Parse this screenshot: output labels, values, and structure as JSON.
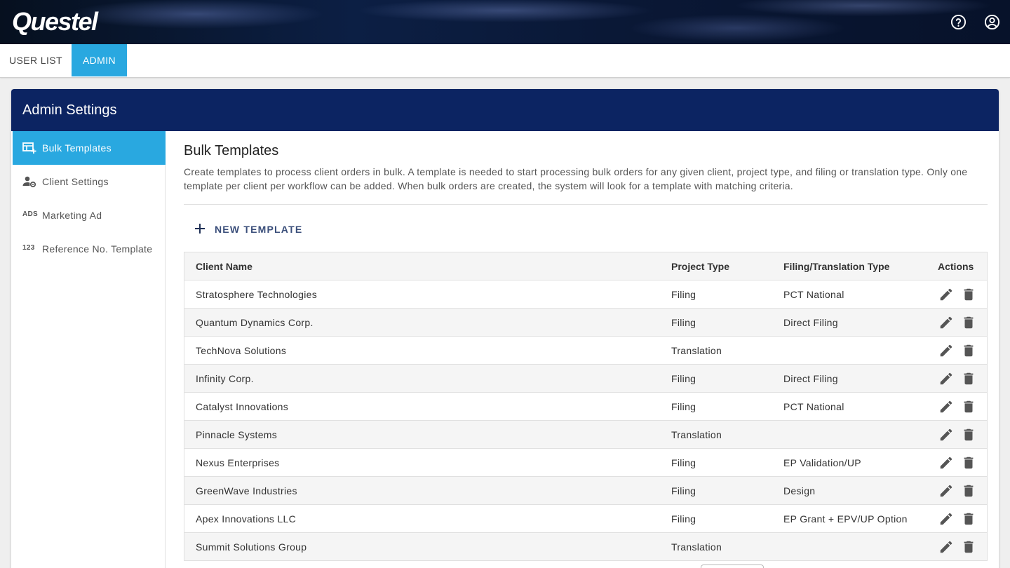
{
  "header": {
    "logo_text": "Questel",
    "help_icon": "help-circle-icon",
    "account_icon": "account-circle-icon"
  },
  "tabs": [
    {
      "label": "USER LIST",
      "active": false
    },
    {
      "label": "ADMIN",
      "active": true
    }
  ],
  "admin": {
    "title": "Admin Settings",
    "sidebar": [
      {
        "label": "Bulk Templates",
        "icon": "table-add-icon",
        "active": true
      },
      {
        "label": "Client Settings",
        "icon": "user-settings-icon",
        "active": false
      },
      {
        "label": "Marketing Ad",
        "icon": "ads-icon",
        "icon_text": "ADS",
        "active": false
      },
      {
        "label": "Reference No. Template",
        "icon": "numbers-icon",
        "icon_text": "123",
        "active": false
      }
    ]
  },
  "main": {
    "title": "Bulk Templates",
    "description": "Create templates to process client orders in bulk. A template is needed to start processing bulk orders for any given client, project type, and filing or translation type. Only one template per client per workflow can be added. When bulk orders are created, the system will look for a template with matching criteria.",
    "new_button_label": "NEW TEMPLATE"
  },
  "table": {
    "columns": [
      "Client Name",
      "Project Type",
      "Filing/Translation Type",
      "Actions"
    ],
    "rows": [
      {
        "client": "Stratosphere Technologies",
        "project": "Filing",
        "filing": "PCT National"
      },
      {
        "client": "Quantum Dynamics Corp.",
        "project": "Filing",
        "filing": "Direct Filing"
      },
      {
        "client": "TechNova Solutions",
        "project": "Translation",
        "filing": ""
      },
      {
        "client": "Infinity Corp.",
        "project": "Filing",
        "filing": "Direct Filing"
      },
      {
        "client": "Catalyst Innovations",
        "project": "Filing",
        "filing": "PCT National"
      },
      {
        "client": "Pinnacle Systems",
        "project": "Translation",
        "filing": ""
      },
      {
        "client": "Nexus Enterprises",
        "project": "Filing",
        "filing": "EP Validation/UP"
      },
      {
        "client": "GreenWave Industries",
        "project": "Filing",
        "filing": "Design"
      },
      {
        "client": "Apex Innovations LLC",
        "project": "Filing",
        "filing": "EP Grant + EPV/UP Option"
      },
      {
        "client": "Summit Solutions Group",
        "project": "Translation",
        "filing": ""
      }
    ],
    "row_actions": [
      "edit-icon",
      "delete-icon"
    ]
  },
  "colors": {
    "accent": "#29a8e0",
    "header_navy": "#0c2462",
    "button_text": "#3a4e7a"
  }
}
